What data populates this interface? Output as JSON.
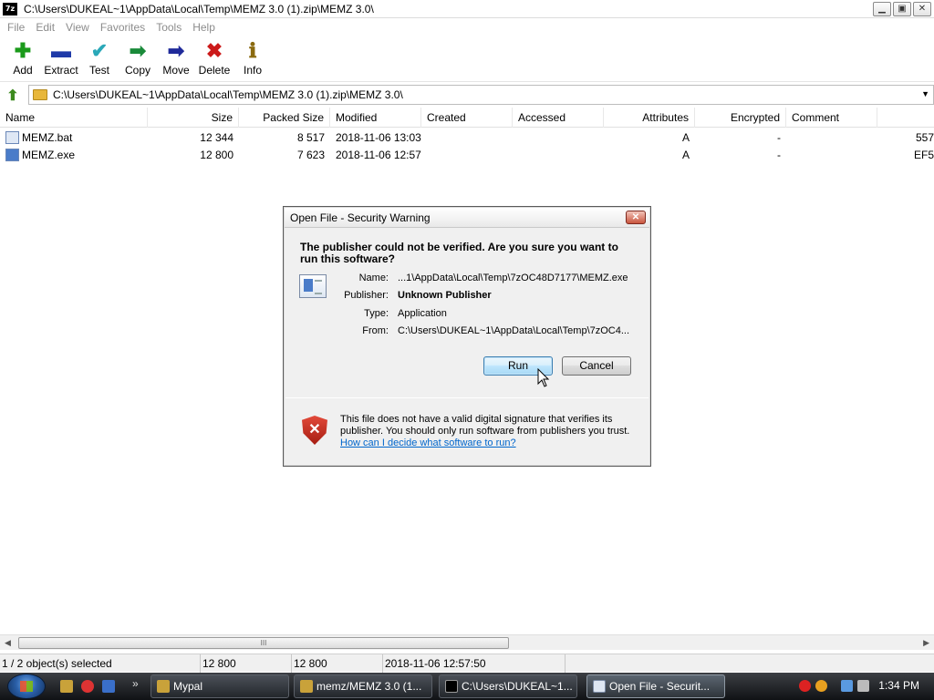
{
  "window": {
    "title": "C:\\Users\\DUKEAL~1\\AppData\\Local\\Temp\\MEMZ 3.0 (1).zip\\MEMZ 3.0\\",
    "app_icon_text": "7z",
    "buttons": {
      "minimize": "▁",
      "maximize": "▣",
      "close": "✕"
    }
  },
  "menu": [
    "File",
    "Edit",
    "View",
    "Favorites",
    "Tools",
    "Help"
  ],
  "toolbar": [
    {
      "label": "Add",
      "icon": "plus-icon",
      "glyph": "✚",
      "color": "#1a9a1a"
    },
    {
      "label": "Extract",
      "icon": "minus-icon",
      "glyph": "▬",
      "color": "#1f3aa8"
    },
    {
      "label": "Test",
      "icon": "check-icon",
      "glyph": "✔",
      "color": "#2aa8b8"
    },
    {
      "label": "Copy",
      "icon": "copy-arrow-icon",
      "glyph": "➡",
      "color": "#1a8a3a"
    },
    {
      "label": "Move",
      "icon": "move-arrow-icon",
      "glyph": "➡",
      "color": "#1f2a9a"
    },
    {
      "label": "Delete",
      "icon": "delete-x-icon",
      "glyph": "✖",
      "color": "#cc1a1a"
    },
    {
      "label": "Info",
      "icon": "info-icon",
      "glyph": "ℹ",
      "color": "#8a6a10"
    }
  ],
  "address": {
    "path": "C:\\Users\\DUKEAL~1\\AppData\\Local\\Temp\\MEMZ 3.0 (1).zip\\MEMZ 3.0\\"
  },
  "columns": [
    "Name",
    "Size",
    "Packed Size",
    "Modified",
    "Created",
    "Accessed",
    "Attributes",
    "Encrypted",
    "Comment"
  ],
  "files": [
    {
      "name": "MEMZ.bat",
      "size": "12 344",
      "packed": "8 517",
      "modified": "2018-11-06 13:03",
      "created": "",
      "accessed": "",
      "attributes": "A",
      "encrypted": "-",
      "comment": "",
      "extra": "557"
    },
    {
      "name": "MEMZ.exe",
      "size": "12 800",
      "packed": "7 623",
      "modified": "2018-11-06 12:57",
      "created": "",
      "accessed": "",
      "attributes": "A",
      "encrypted": "-",
      "comment": "",
      "extra": "EF5"
    }
  ],
  "scrollbar": {
    "grip": "III",
    "left_arrow": "◀",
    "right_arrow": "▶"
  },
  "status": {
    "selection": "1 / 2 object(s) selected",
    "size": "12 800",
    "packed": "12 800",
    "modified": "2018-11-06 12:57:50"
  },
  "dialog": {
    "title": "Open File - Security Warning",
    "close": "✕",
    "question": "The publisher could not be verified.  Are you sure you want to run this software?",
    "fields": {
      "name_label": "Name:",
      "name_value": "...1\\AppData\\Local\\Temp\\7zOC48D7177\\MEMZ.exe",
      "publisher_label": "Publisher:",
      "publisher_value": "Unknown Publisher",
      "type_label": "Type:",
      "type_value": "Application",
      "from_label": "From:",
      "from_value": "C:\\Users\\DUKEAL~1\\AppData\\Local\\Temp\\7zOC4..."
    },
    "run_label": "Run",
    "cancel_label": "Cancel",
    "warning_text": "This file does not have a valid digital signature that verifies its publisher.  You should only run software from publishers you trust.",
    "help_link": "How can I decide what software to run?",
    "shield_glyph": "✕"
  },
  "taskbar": {
    "more": "»",
    "tasks": [
      {
        "label": "Mypal",
        "active": false
      },
      {
        "label": "memz/MEMZ 3.0 (1...",
        "active": false
      },
      {
        "label": "C:\\Users\\DUKEAL~1...",
        "active": false
      },
      {
        "label": "Open File - Securit...",
        "active": true
      }
    ],
    "clock": "1:34 PM"
  }
}
